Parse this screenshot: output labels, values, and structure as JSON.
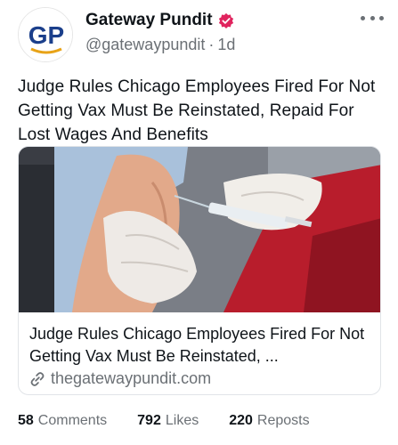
{
  "account": {
    "display_name": "Gateway Pundit",
    "avatar_initials": "GP",
    "handle": "@gatewaypundit",
    "separator": "·",
    "age": "1d"
  },
  "post": {
    "text": "Judge Rules Chicago Employees Fired For Not Getting Vax Must Be Reinstated, Repaid For Lost Wages And Benefits"
  },
  "link_card": {
    "title": "Judge Rules Chicago Employees Fired For Not Getting Vax Must Be Reinstated, ...",
    "domain": "thegatewaypundit.com"
  },
  "stats": {
    "comments": {
      "count": "58",
      "label": "Comments"
    },
    "likes": {
      "count": "792",
      "label": "Likes"
    },
    "reposts": {
      "count": "220",
      "label": "Reposts"
    }
  },
  "colors": {
    "brand_blue": "#1b3f8b",
    "verified_red": "#e0245e",
    "muted_text": "#6b7075"
  },
  "icons": {
    "verified": "verified-badge-icon",
    "more": "more-dots-icon",
    "link": "link-icon"
  }
}
